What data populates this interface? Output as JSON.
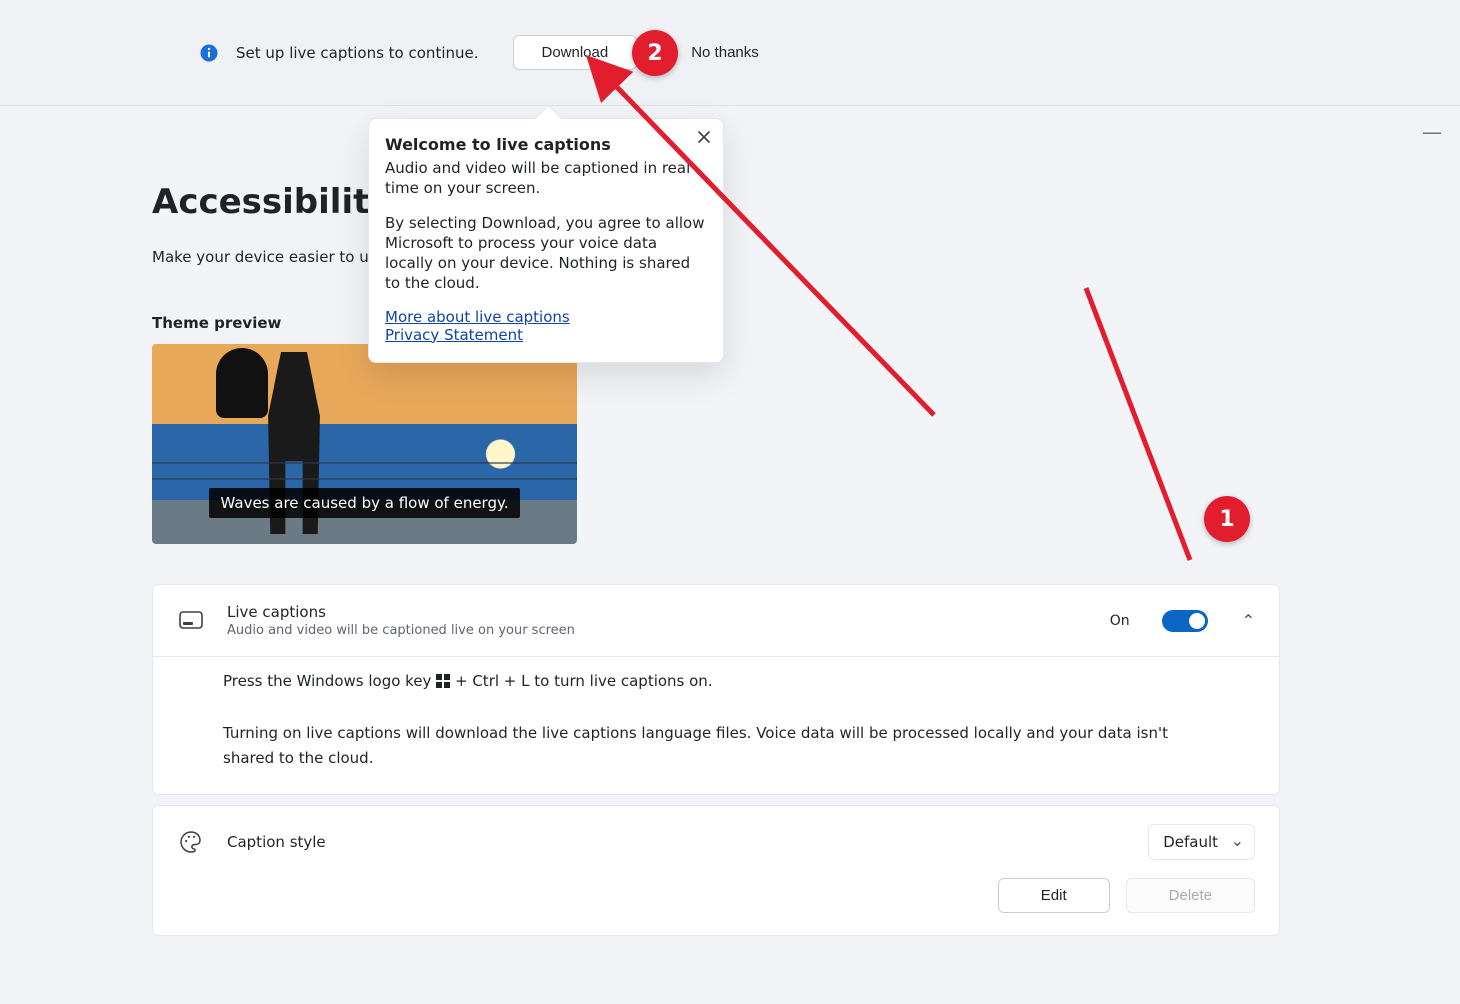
{
  "banner": {
    "text": "Set up live captions to continue.",
    "download": "Download",
    "no_thanks": "No thanks"
  },
  "popover": {
    "title": "Welcome to live captions",
    "p1": "Audio and video will be captioned in real time on your screen.",
    "p2": "By selecting Download, you agree to allow Microsoft to process your voice data locally on your device. Nothing is shared to the cloud.",
    "link1": "More about live captions",
    "link2": "Privacy Statement"
  },
  "breadcrumb": {
    "root": "Accessibility"
  },
  "subhead": "Make your device easier to use",
  "theme_label": "Theme preview",
  "preview_caption": "Waves are caused by a flow of energy.",
  "live_captions": {
    "title": "Live captions",
    "desc": "Audio and video will be captioned live on your screen",
    "state": "On",
    "detail_a": "Press the Windows logo key",
    "detail_b": "+ Ctrl + L to turn live captions on.",
    "detail2": "Turning on live captions will download the live captions language files. Voice data will be processed locally and your data isn't shared to the cloud."
  },
  "caption_style": {
    "title": "Caption style",
    "value": "Default",
    "edit": "Edit",
    "delete": "Delete"
  },
  "annotations": {
    "step1": "1",
    "step2": "2"
  }
}
